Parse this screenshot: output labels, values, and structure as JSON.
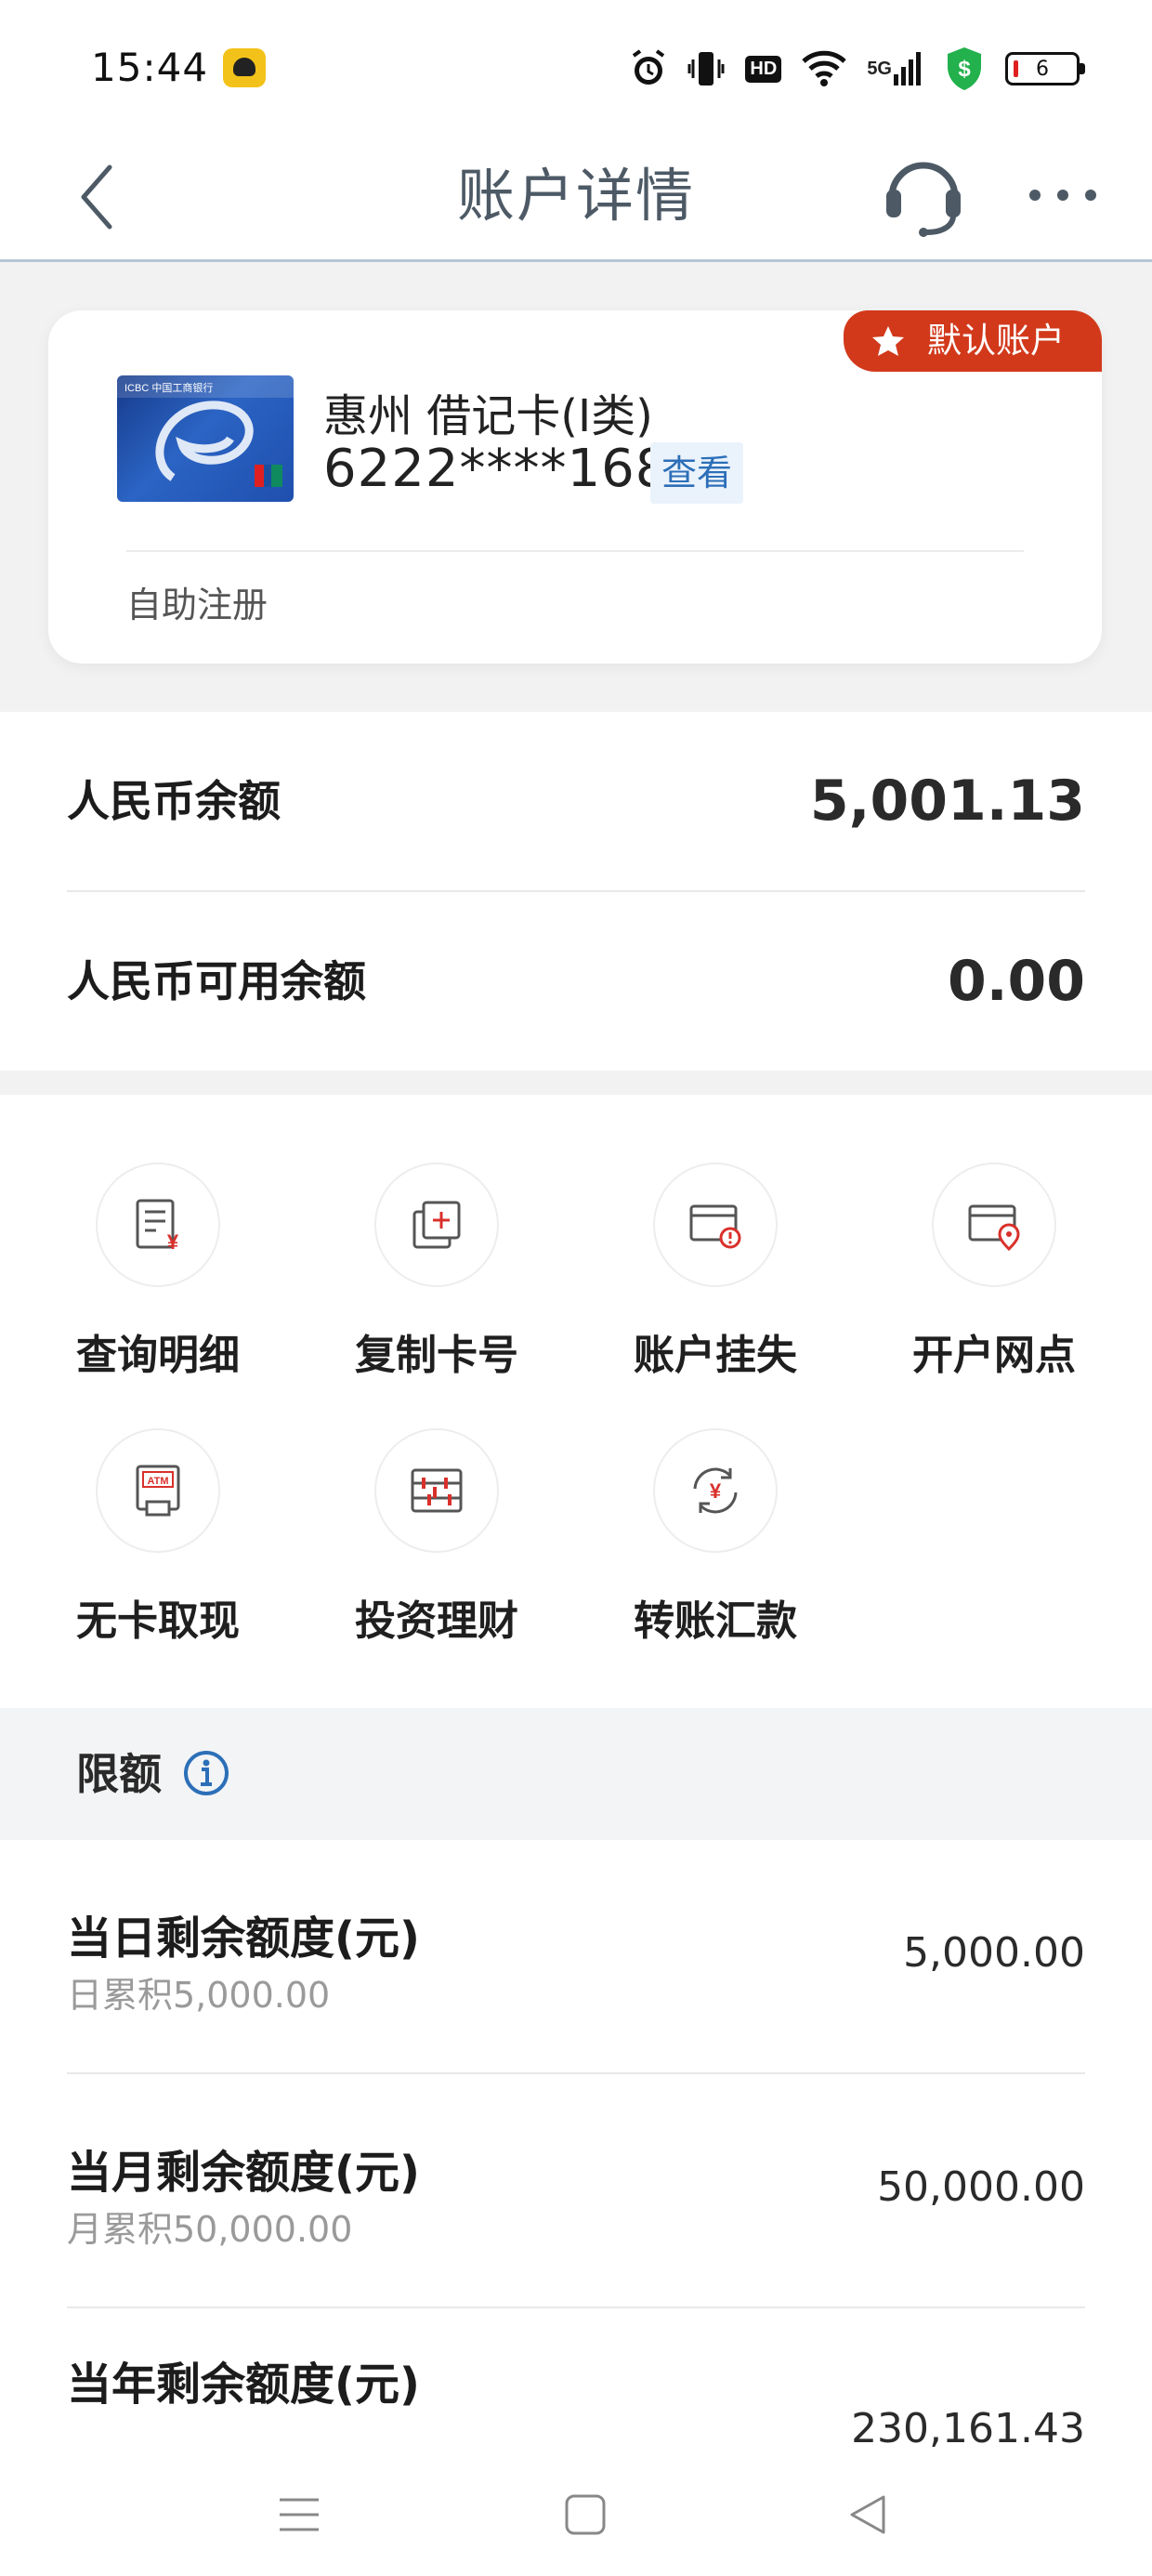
{
  "status_bar": {
    "time": "15:44",
    "battery": "6",
    "hd_label": "HD",
    "network_label": "5G",
    "icons": [
      "app-notification-icon",
      "alarm-icon",
      "vibrate-icon",
      "hd-icon",
      "wifi-icon",
      "5g-signal-icon",
      "security-shield-icon",
      "battery-icon"
    ]
  },
  "header": {
    "title": "账户详情",
    "icons": [
      "back-chevron-icon",
      "headset-icon",
      "more-dots-icon"
    ]
  },
  "account_card": {
    "badge": "默认账户",
    "name": "惠州 借记卡(I类)",
    "number": "6222****1682",
    "view_label": "查看",
    "footer": "自助注册",
    "thumb_text": "ICBC 中国工商银行"
  },
  "balances": [
    {
      "label": "人民币余额",
      "value": "5,001.13"
    },
    {
      "label": "人民币可用余额",
      "value": "0.00"
    }
  ],
  "actions": [
    {
      "label": "查询明细",
      "icon": "detail-receipt-icon"
    },
    {
      "label": "复制卡号",
      "icon": "copy-card-icon"
    },
    {
      "label": "账户挂失",
      "icon": "report-loss-icon"
    },
    {
      "label": "开户网点",
      "icon": "branch-location-icon"
    },
    {
      "label": "无卡取现",
      "icon": "atm-icon"
    },
    {
      "label": "投资理财",
      "icon": "abacus-icon"
    },
    {
      "label": "转账汇款",
      "icon": "transfer-yen-icon"
    }
  ],
  "atm_text": "ATM",
  "limits": {
    "title": "限额",
    "rows": [
      {
        "title": "当日剩余额度(元)",
        "sub": "日累积5,000.00",
        "value": "5,000.00"
      },
      {
        "title": "当月剩余额度(元)",
        "sub": "月累积50,000.00",
        "value": "50,000.00"
      },
      {
        "title": "当年剩余额度(元)",
        "sub": "",
        "value": "230,161.43"
      }
    ]
  },
  "colors": {
    "badge_red": "#d2391b",
    "link_blue": "#2c6fb8",
    "icon_red": "#d9302b",
    "title_gray": "#4d5a66"
  }
}
